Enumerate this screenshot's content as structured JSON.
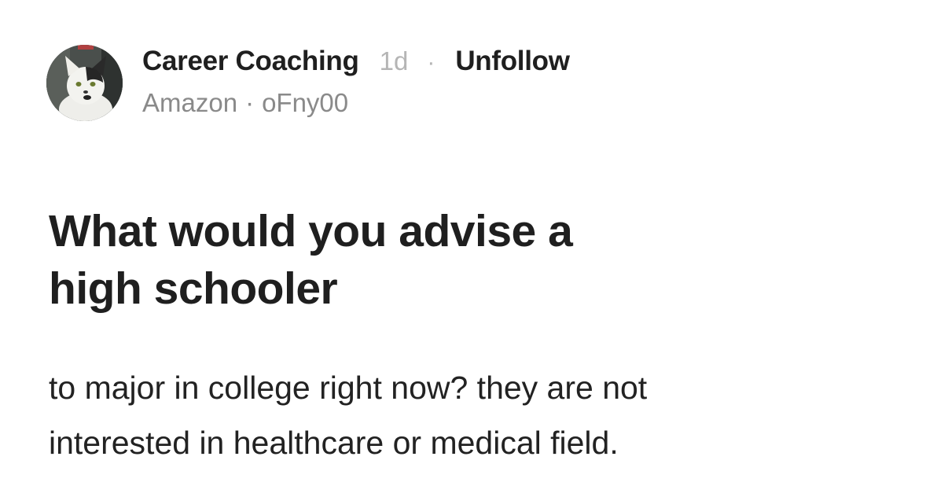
{
  "post": {
    "channel_name": "Career Coaching",
    "time_ago": "1d",
    "separator": "·",
    "unfollow_label": "Unfollow",
    "author_company": "Amazon",
    "author_sep": "·",
    "author_handle": "oFny00",
    "title_line1": "What would you advise a",
    "title_line2": "high schooler",
    "body_line1": "to major in college right now? they are not",
    "body_line2": "interested in healthcare or medical field."
  },
  "avatar": {
    "icon": "cat-avatar-icon"
  },
  "colors": {
    "background": "#ffffff",
    "primary_text": "#1f1f1f",
    "secondary_text": "#8a8a8a",
    "muted_text": "#b5b5b5"
  }
}
